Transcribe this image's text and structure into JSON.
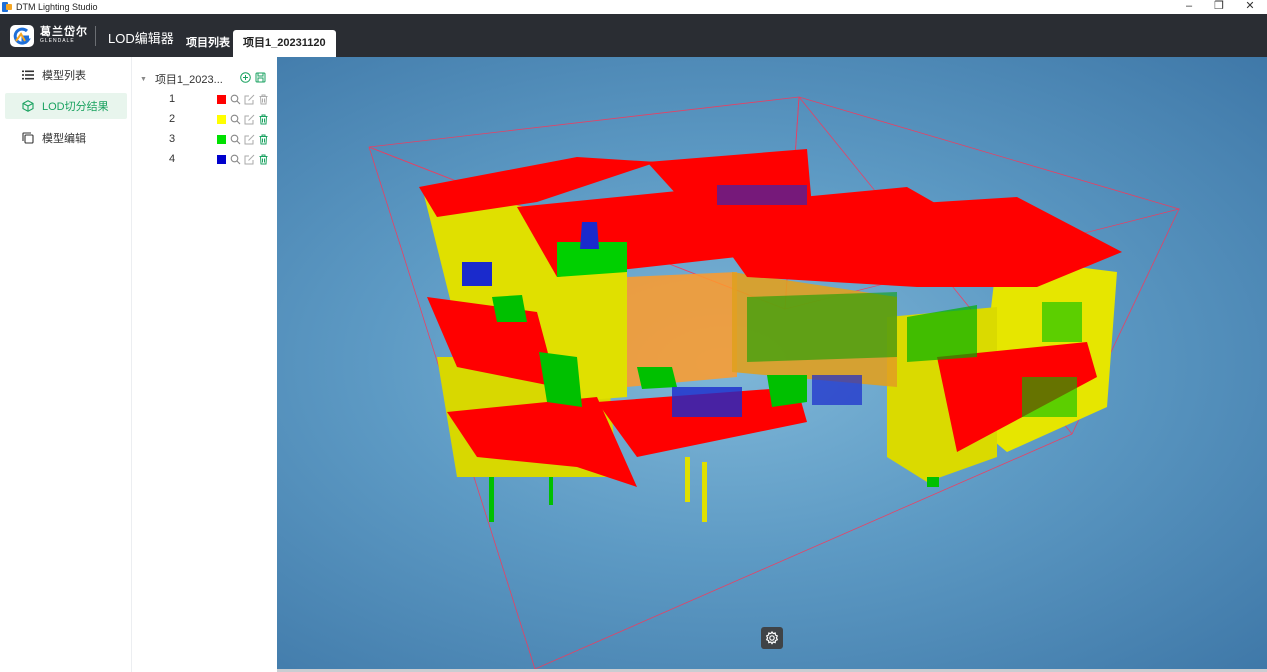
{
  "window": {
    "title": "DTM Lighting Studio",
    "controls": {
      "minimize": "–",
      "restore": "❐",
      "close": "✕"
    }
  },
  "header": {
    "logo_cn": "葛兰岱尔",
    "logo_en": "GLENDALE",
    "title": "LOD编辑器",
    "tabs": [
      {
        "label": "项目列表",
        "active": false
      },
      {
        "label": "项目1_20231120",
        "active": true
      }
    ]
  },
  "sidebar": {
    "items": [
      {
        "label": "模型列表",
        "icon": "list-icon",
        "active": false
      },
      {
        "label": "LOD切分结果",
        "icon": "cube-icon",
        "active": true
      },
      {
        "label": "模型编辑",
        "icon": "layers-icon",
        "active": false
      }
    ]
  },
  "tree": {
    "root_label": "项目1_2023...",
    "levels": [
      {
        "num": "1",
        "color": "#ff0000"
      },
      {
        "num": "2",
        "color": "#ffff00"
      },
      {
        "num": "3",
        "color": "#00e000"
      },
      {
        "num": "4",
        "color": "#0000cc"
      }
    ]
  },
  "theme": {
    "accent": "#1aa260",
    "header_bg": "#2a2d33"
  }
}
